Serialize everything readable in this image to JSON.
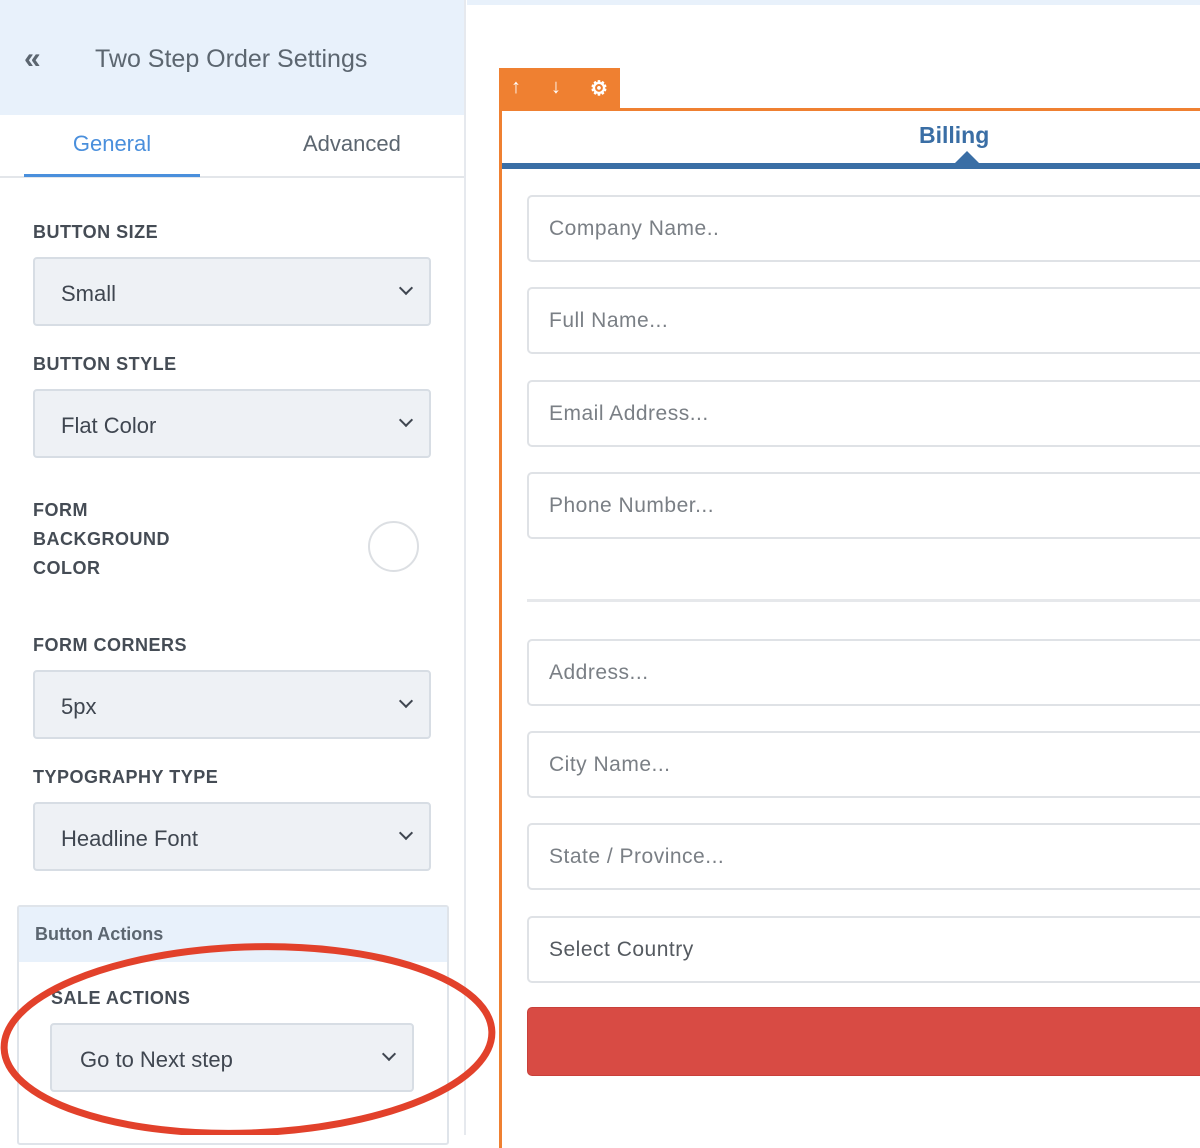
{
  "panel": {
    "back_icon": "«",
    "title": "Two Step Order Settings",
    "tabs": [
      "General",
      "Advanced"
    ],
    "button_size": {
      "label": "BUTTON SIZE",
      "value": "Small"
    },
    "button_style": {
      "label": "BUTTON STYLE",
      "value": "Flat Color"
    },
    "form_bg": {
      "label": [
        "FORM",
        "BACKGROUND",
        "COLOR"
      ]
    },
    "form_corners": {
      "label": "FORM CORNERS",
      "value": "5px"
    },
    "typography": {
      "label": "TYPOGRAPHY TYPE",
      "value": "Headline Font"
    },
    "button_actions": {
      "title": "Button Actions",
      "sale_label": "SALE ACTIONS",
      "sale_value": "Go to Next step"
    }
  },
  "preview": {
    "toolbar": {
      "up": "↑",
      "down": "↓",
      "gear": "⚙"
    },
    "tab": "Billing",
    "fields": [
      "Company Name..",
      "Full Name...",
      "Email Address...",
      "Phone Number..."
    ],
    "address_fields": [
      "Address...",
      "City Name...",
      "State / Province...",
      "Select Country"
    ],
    "accent": "#ef8031",
    "button_color": "#d84b44"
  }
}
